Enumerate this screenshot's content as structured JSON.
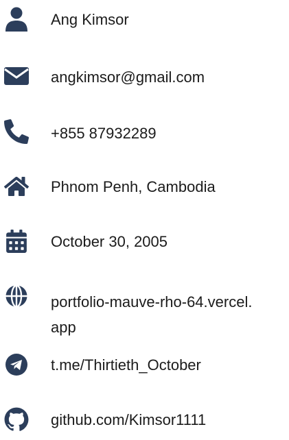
{
  "icon_color": "#2c3e5b",
  "contact": {
    "name": {
      "icon": "user-icon",
      "text": "Ang Kimsor"
    },
    "email": {
      "icon": "envelope-icon",
      "text": "angkimsor@gmail.com"
    },
    "phone": {
      "icon": "phone-icon",
      "text": "+855 87932289"
    },
    "address": {
      "icon": "home-icon",
      "text": "Phnom Penh, Cambodia"
    },
    "birthday": {
      "icon": "calendar-icon",
      "text": "October 30, 2005"
    },
    "website": {
      "icon": "globe-icon",
      "line1": "portfolio-mauve-rho-64.vercel.",
      "line2": "app"
    },
    "telegram": {
      "icon": "telegram-icon",
      "text": "t.me/Thirtieth_October"
    },
    "github": {
      "icon": "github-icon",
      "text": "github.com/Kimsor1111"
    }
  }
}
